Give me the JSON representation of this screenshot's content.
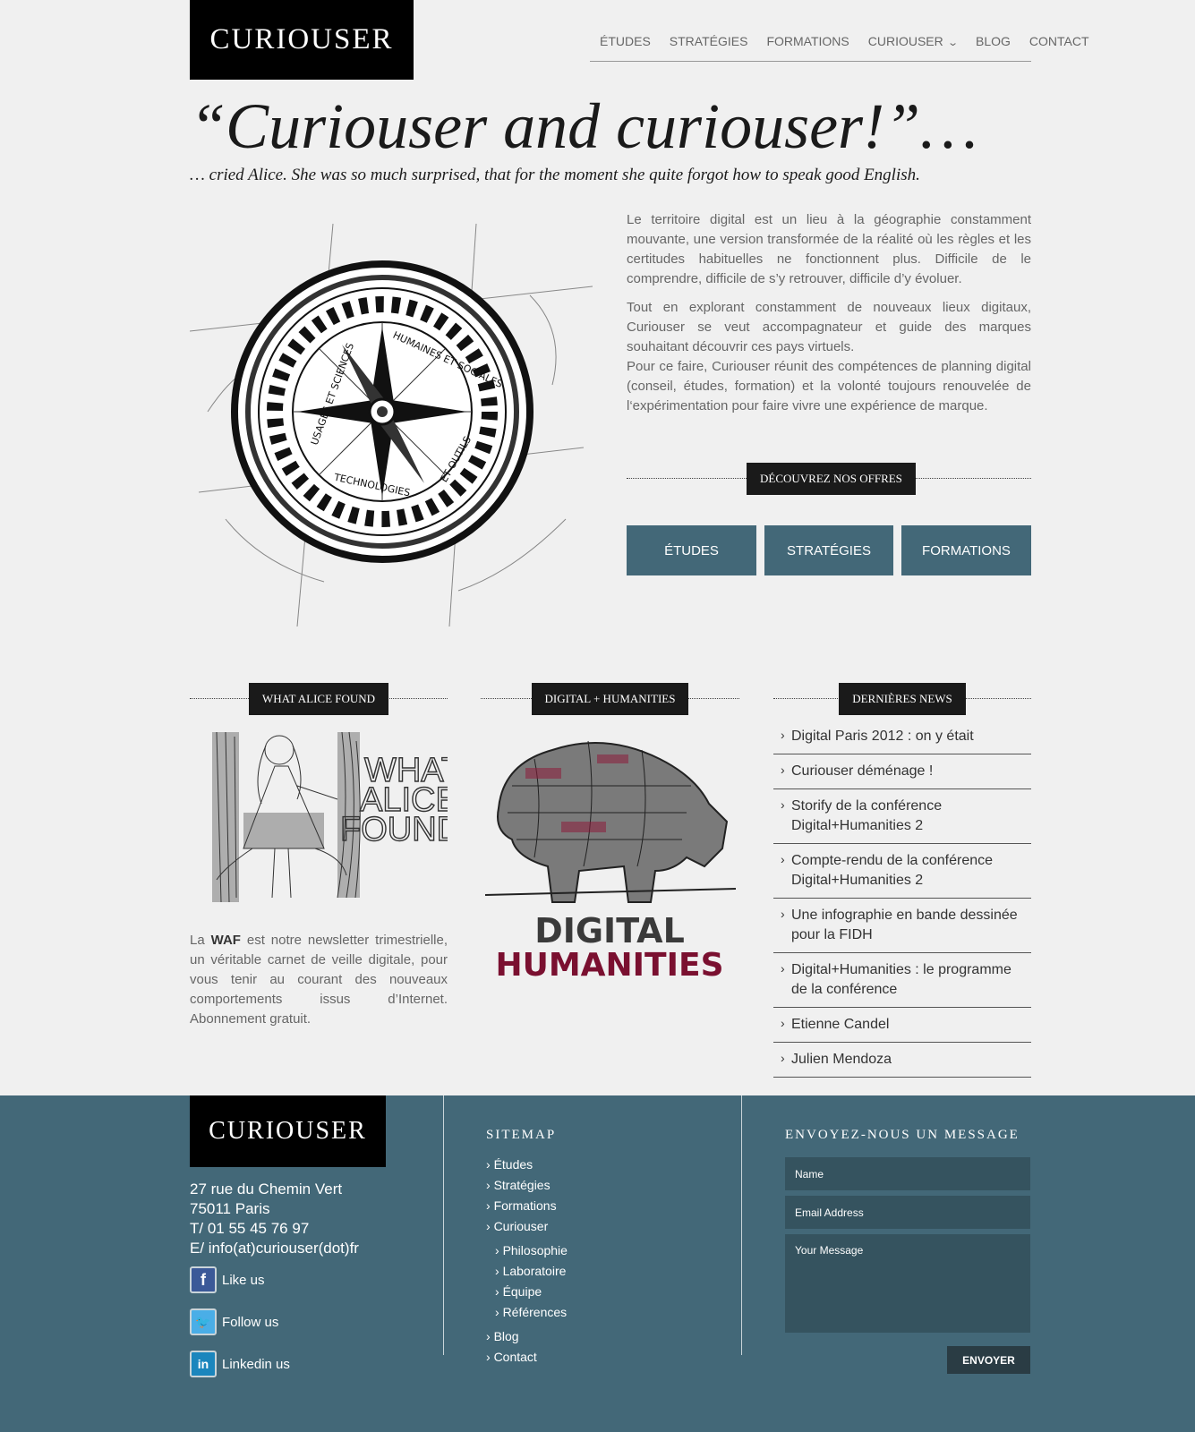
{
  "header": {
    "logo": "CURIOUSER",
    "nav": [
      "ÉTUDES",
      "STRATÉGIES",
      "FORMATIONS",
      "CURIOUSER",
      "BLOG",
      "CONTACT"
    ]
  },
  "hero": {
    "title": "“Curiouser and curiouser!”…",
    "subtitle": "… cried Alice. She was so much surprised, that for the moment she quite forgot how to speak good English."
  },
  "compass": {
    "ring_top": "HUMAINES ET SOCIALES",
    "ring_left": "USAGES ET SCIENCES",
    "ring_bottom": "TECHNOLOGIES",
    "ring_right": "ET OUTILS"
  },
  "intro": {
    "p1": "Le territoire digital est un lieu à la géographie constamment mouvante, une version transformée de la réalité où les règles et les certitudes habituelles ne fonctionnent plus. Difficile de le comprendre, difficile de s’y retrouver, difficile d’y évoluer.",
    "p2": "Tout en explorant constamment de nouveaux lieux digitaux, Curiouser se veut accompagnateur et guide des marques souhaitant découvrir ces pays virtuels.",
    "p3": "Pour ce faire, Curiouser réunit des compétences de planning digital (conseil, études, formation) et la volonté toujours renouvelée de l‘expérimentation pour faire vivre une expérience de marque."
  },
  "offers": {
    "heading": "DÉCOUVREZ NOS OFFRES",
    "buttons": [
      "ÉTUDES",
      "STRATÉGIES",
      "FORMATIONS"
    ]
  },
  "waf": {
    "heading": "WHAT ALICE FOUND",
    "image_text": [
      "WHAT",
      "ALICE",
      "FOUND"
    ],
    "text_before": "La ",
    "text_bold": "WAF",
    "text_after": " est notre newsletter trimestrielle, un véritable carnet de veille digitale, pour vous tenir au courant des nouveaux comportements issus d’Internet. Abonnement gratuit."
  },
  "dh": {
    "heading": "DIGITAL + HUMANITIES",
    "image_word1": "DIGITAL",
    "image_word2": "HUMANITIES"
  },
  "news": {
    "heading": "DERNIÈRES NEWS",
    "items": [
      "Digital Paris 2012 : on y était",
      "Curiouser déménage !",
      "Storify de la conférence Digital+Humanities 2",
      "Compte-rendu de la conférence Digital+Humanities 2",
      "Une infographie en bande dessinée pour la FIDH",
      "Digital+Humanities : le programme de la conférence",
      "Etienne Candel",
      "Julien Mendoza"
    ]
  },
  "footer": {
    "logo": "CURIOUSER",
    "address": [
      "27 rue du Chemin Vert",
      "75011 Paris",
      "T/ 01 55 45 76 97",
      "E/ info(at)curiouser(dot)fr"
    ],
    "social": [
      "Like us",
      "Follow us",
      "Linkedin us"
    ],
    "sitemap_title": "SITEMAP",
    "sitemap": [
      "Études",
      "Stratégies",
      "Formations",
      "Curiouser",
      "Philosophie",
      "Laboratoire",
      "Équipe",
      "Références",
      "Blog",
      "Contact"
    ],
    "form_title": "ENVOYEZ-NOUS UN MESSAGE",
    "placeholders": {
      "name": "Name",
      "email": "Email Address",
      "message": "Your Message"
    },
    "send": "ENVOYER"
  },
  "colors": {
    "accent": "#436878",
    "dark": "#1a1a1a",
    "field": "#35535f"
  }
}
